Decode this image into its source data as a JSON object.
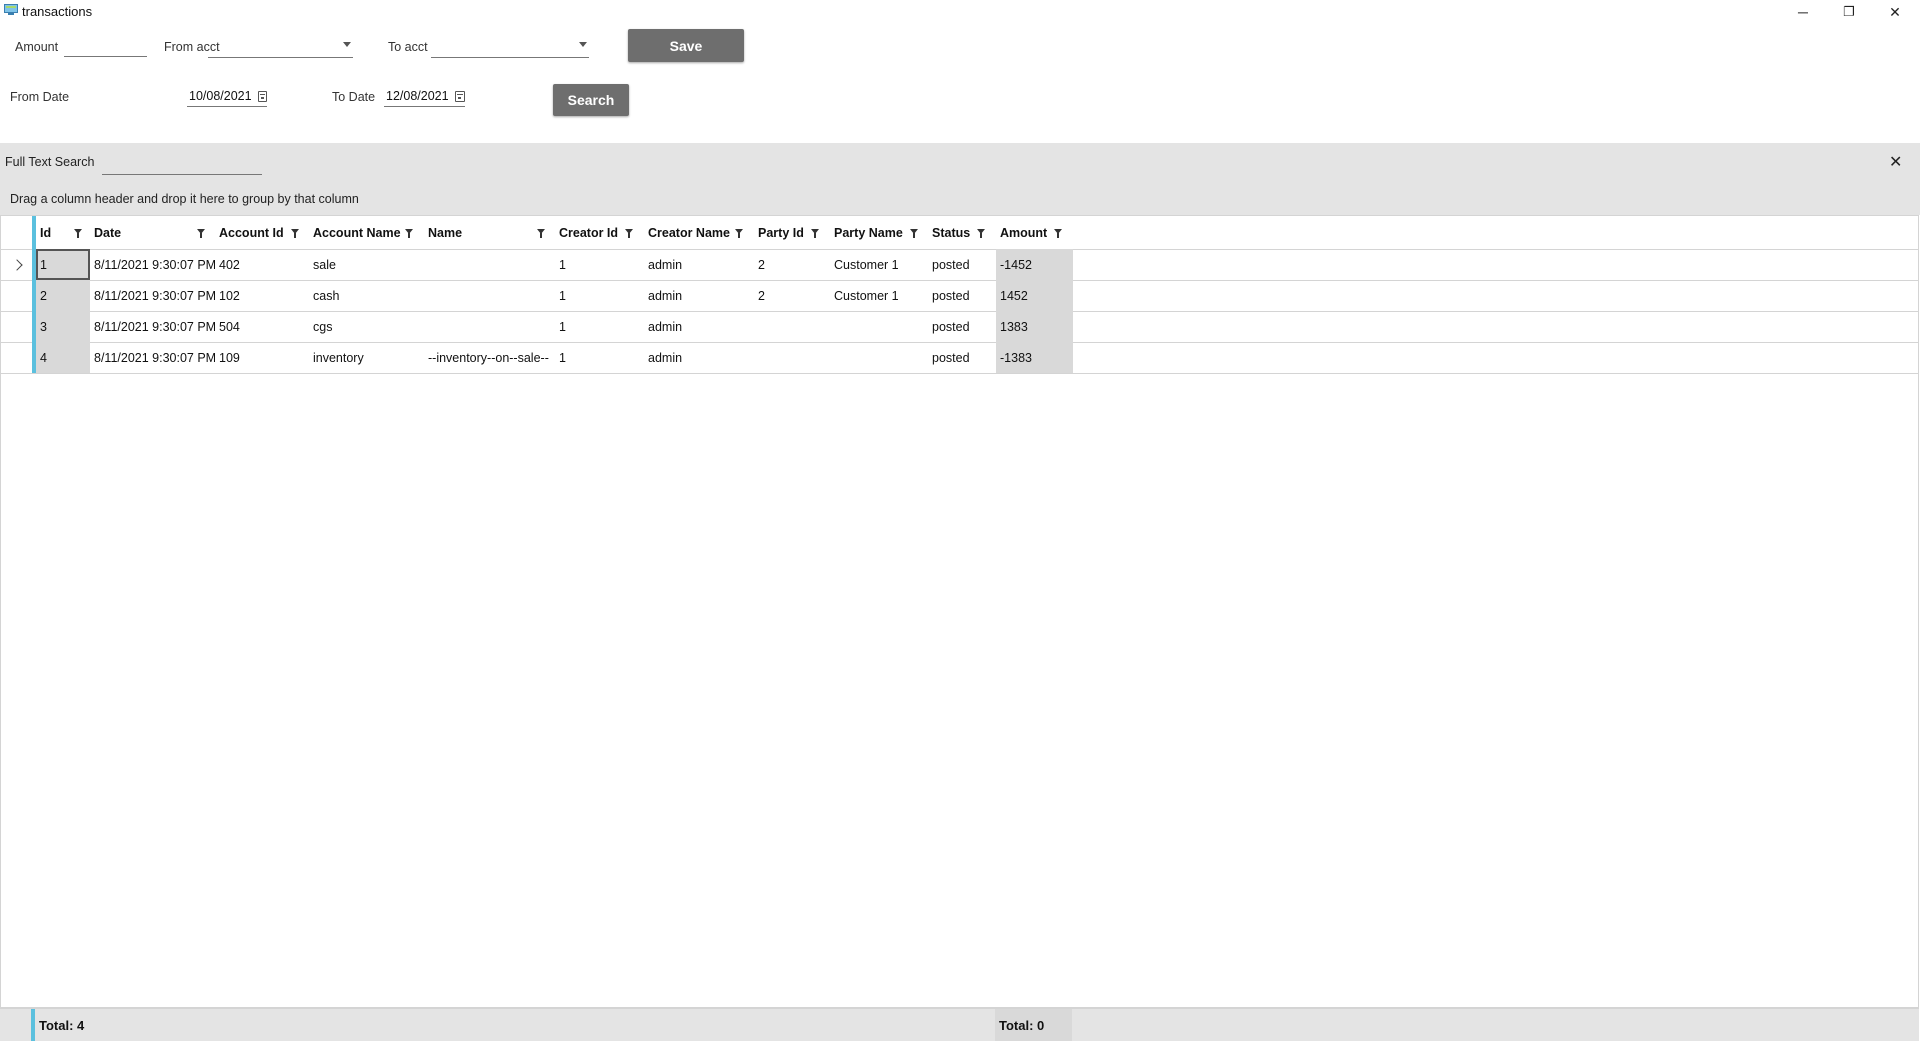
{
  "window": {
    "title": "transactions",
    "minimize": "─",
    "restore": "❐",
    "close": "✕"
  },
  "form": {
    "amount_label": "Amount",
    "amount_value": "",
    "from_acct_label": "From acct",
    "from_acct_value": "",
    "to_acct_label": "To acct",
    "to_acct_value": "",
    "save_label": "Save",
    "from_date_label": "From Date",
    "from_date_value": "10/08/2021",
    "to_date_label": "To Date",
    "to_date_value": "12/08/2021",
    "search_label": "Search"
  },
  "full_text_search": {
    "label": "Full Text Search",
    "value": "",
    "close": "✕"
  },
  "grid": {
    "group_panel_text": "Drag a column header and drop it here to group by that column",
    "columns": [
      "Id",
      "Date",
      "Account Id",
      "Account Name",
      "Name",
      "Creator Id",
      "Creator Name",
      "Party Id",
      "Party Name",
      "Status",
      "Amount"
    ],
    "rows": [
      [
        "1",
        "8/11/2021 9:30:07 PM",
        "402",
        "sale",
        "",
        "1",
        "admin",
        "2",
        "Customer 1",
        "posted",
        "-1452"
      ],
      [
        "2",
        "8/11/2021 9:30:07 PM",
        "102",
        "cash",
        "",
        "1",
        "admin",
        "2",
        "Customer 1",
        "posted",
        "1452"
      ],
      [
        "3",
        "8/11/2021 9:30:07 PM",
        "504",
        "cgs",
        "",
        "1",
        "admin",
        "",
        "",
        "posted",
        "1383"
      ],
      [
        "4",
        "8/11/2021 9:30:07 PM",
        "109",
        "inventory",
        "--inventory--on--sale--",
        "1",
        "admin",
        "",
        "",
        "posted",
        "-1383"
      ]
    ],
    "footer": {
      "id_total": "Total: 4",
      "amount_total": "Total: 0"
    }
  },
  "colors": {
    "accent": "#5bc0de",
    "button": "#6e6e6e",
    "band": "#e4e4e4"
  }
}
